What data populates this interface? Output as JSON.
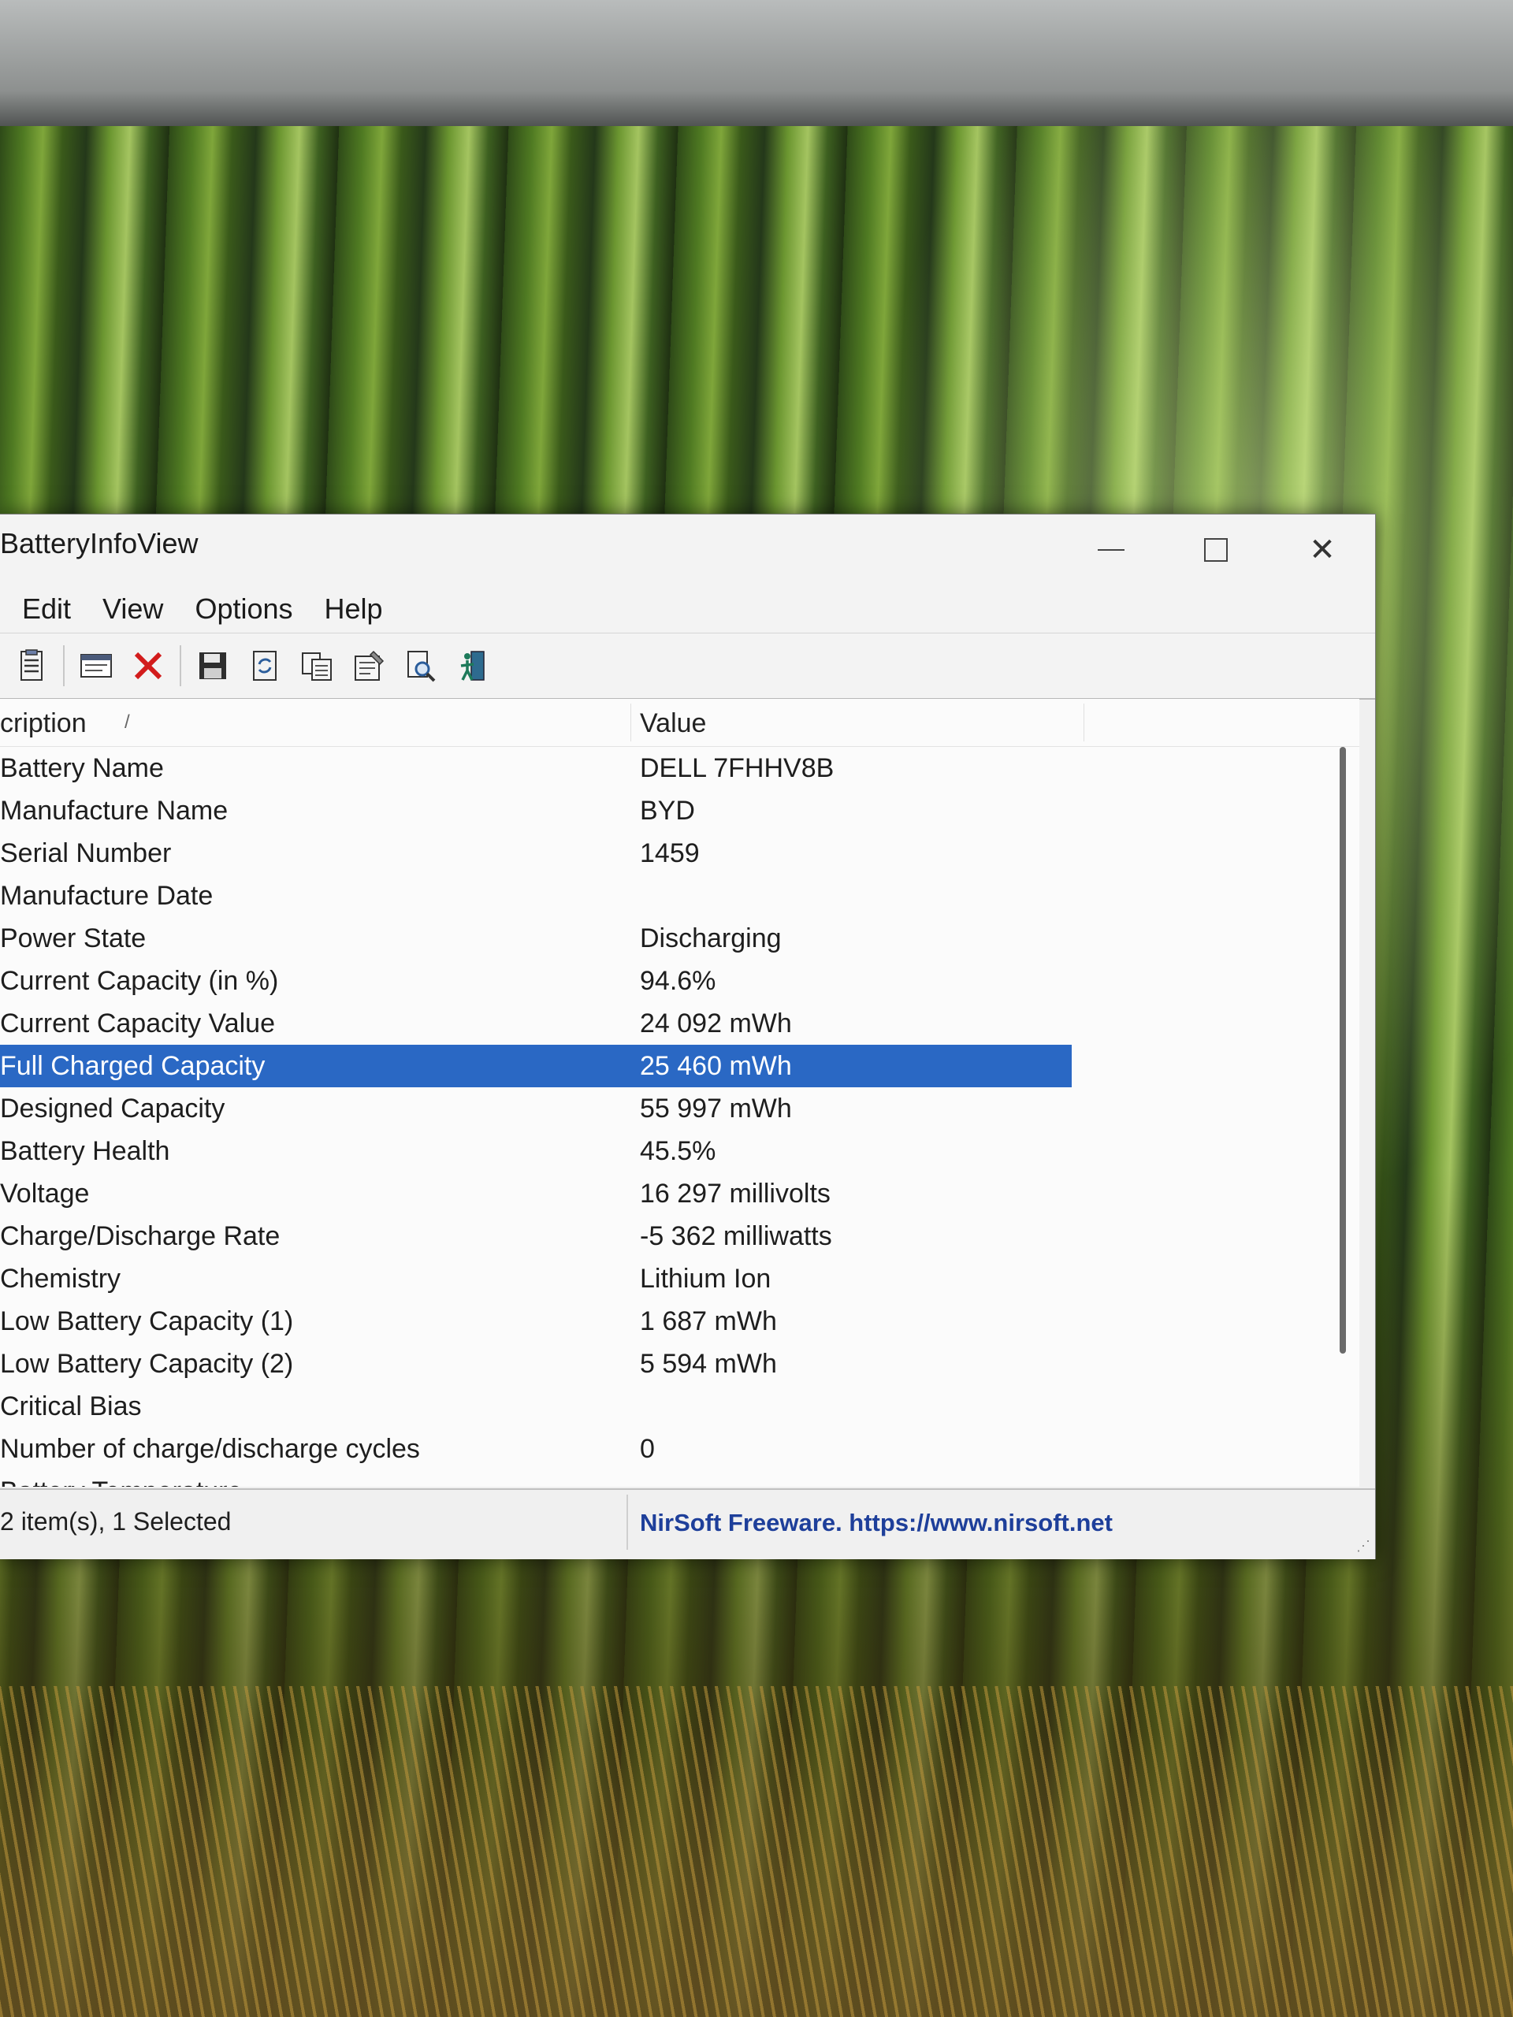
{
  "window": {
    "title": "BatteryInfoView",
    "controls": {
      "minimize": "—",
      "close": "✕"
    }
  },
  "menubar": {
    "items": [
      "Edit",
      "View",
      "Options",
      "Help"
    ]
  },
  "toolbar": {
    "icons": [
      "properties-icon",
      "html-report-icon",
      "delete-icon",
      "save-icon",
      "refresh-icon",
      "copy-icon",
      "properties-sheet-icon",
      "find-icon",
      "exit-icon"
    ]
  },
  "grid": {
    "columns": {
      "description": "cription",
      "sort_indicator": "/",
      "value": "Value"
    },
    "rows": [
      {
        "description": "Battery Name",
        "value": "DELL 7FHHV8B"
      },
      {
        "description": "Manufacture Name",
        "value": "BYD"
      },
      {
        "description": "Serial Number",
        "value": "1459"
      },
      {
        "description": "Manufacture Date",
        "value": ""
      },
      {
        "description": "Power State",
        "value": "Discharging"
      },
      {
        "description": "Current Capacity (in %)",
        "value": "94.6%"
      },
      {
        "description": "Current Capacity Value",
        "value": "24 092 mWh"
      },
      {
        "description": "Full Charged Capacity",
        "value": "25 460 mWh",
        "selected": true
      },
      {
        "description": "Designed Capacity",
        "value": "55 997 mWh"
      },
      {
        "description": "Battery Health",
        "value": "45.5%"
      },
      {
        "description": "Voltage",
        "value": "16 297 millivolts"
      },
      {
        "description": "Charge/Discharge Rate",
        "value": "-5 362 milliwatts"
      },
      {
        "description": "Chemistry",
        "value": "Lithium Ion"
      },
      {
        "description": "Low Battery Capacity (1)",
        "value": "1 687 mWh"
      },
      {
        "description": "Low Battery Capacity (2)",
        "value": "5 594 mWh"
      },
      {
        "description": "Critical Bias",
        "value": ""
      },
      {
        "description": "Number of charge/discharge cycles",
        "value": "0"
      },
      {
        "description": "Battery Temperature",
        "value": ""
      }
    ]
  },
  "statusbar": {
    "items_text": "2 item(s), 1 Selected",
    "credit": "NirSoft Freeware. https://www.nirsoft.net"
  },
  "colors": {
    "selection": "#2a68c4",
    "credit_link": "#1e3f9a"
  }
}
